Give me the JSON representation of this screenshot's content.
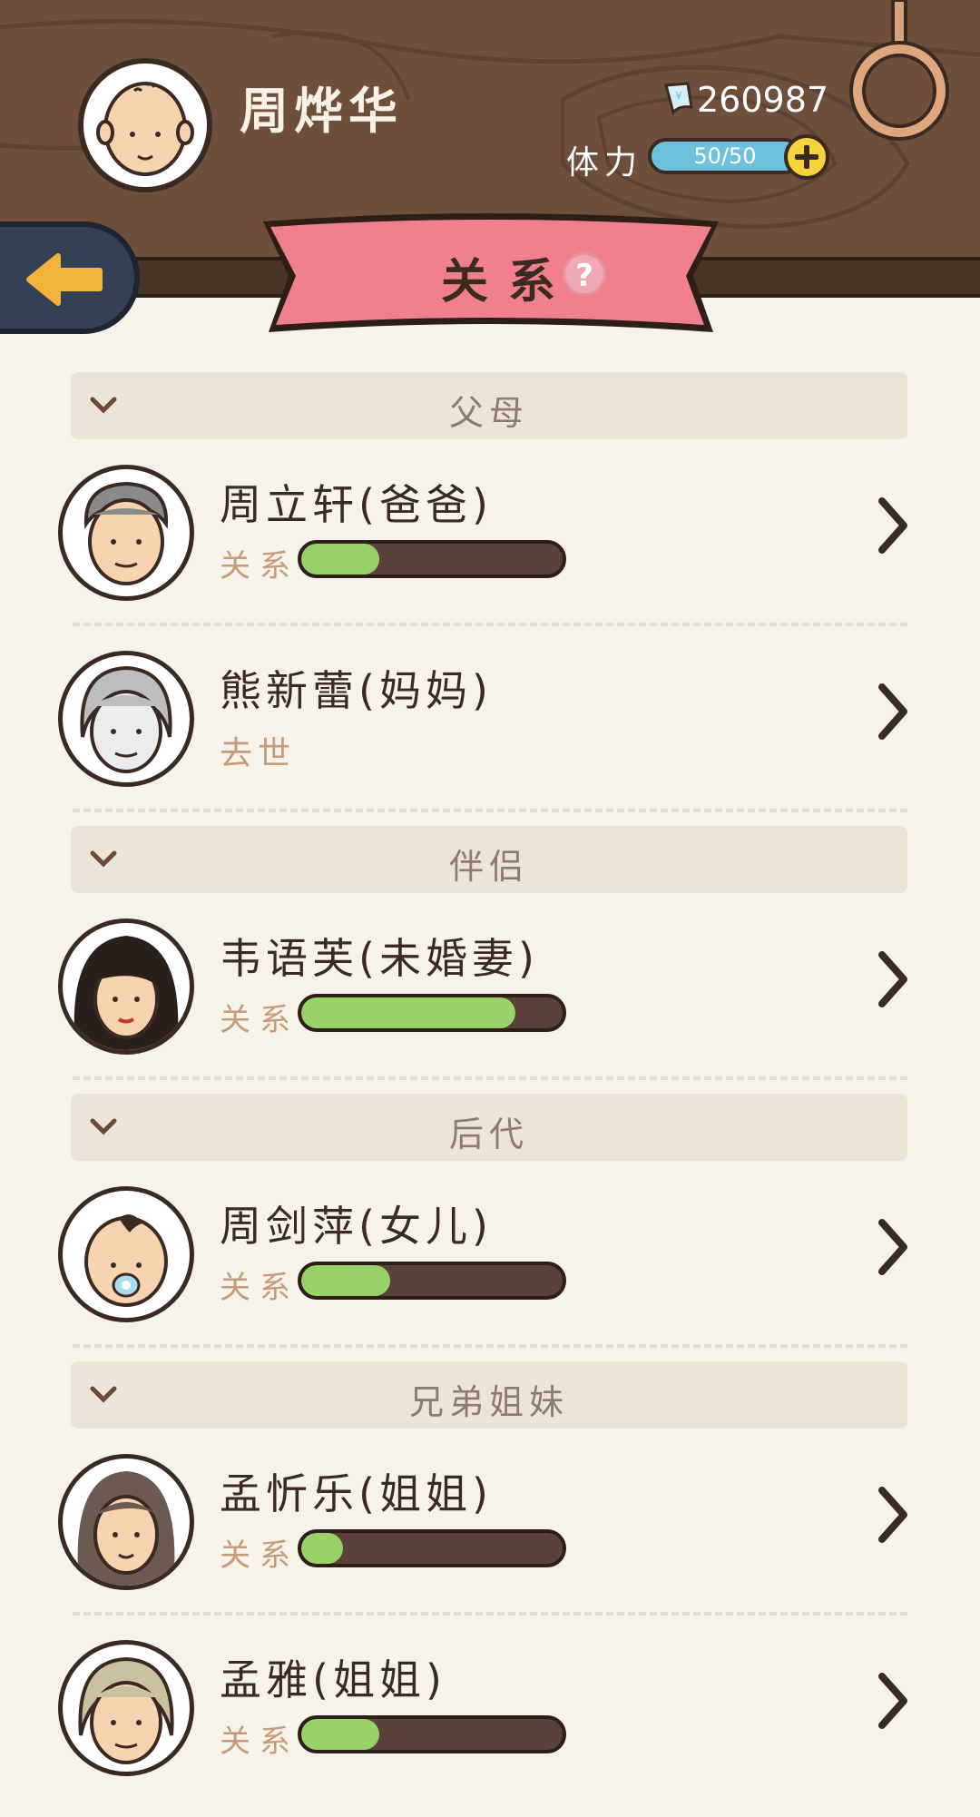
{
  "header": {
    "player_name": "周烨华",
    "money": "260987",
    "stamina_label": "体力",
    "stamina_value": "50/50"
  },
  "banner": {
    "title": "关系",
    "help": "?"
  },
  "sections": [
    {
      "title": "父母"
    },
    {
      "title": "伴侣"
    },
    {
      "title": "后代"
    },
    {
      "title": "兄弟姐妹"
    }
  ],
  "relationship_label": "关系",
  "people": [
    {
      "name": "周立轩(爸爸)",
      "relationship": 0.3,
      "status": "",
      "avatar": "old-man-avatar"
    },
    {
      "name": "熊新蕾(妈妈)",
      "relationship": null,
      "status": "去世",
      "avatar": "old-woman-grey-avatar"
    },
    {
      "name": "韦语芙(未婚妻)",
      "relationship": 0.82,
      "status": "",
      "avatar": "woman-avatar"
    },
    {
      "name": "周剑萍(女儿)",
      "relationship": 0.34,
      "status": "",
      "avatar": "baby-avatar"
    },
    {
      "name": "孟忻乐(姐姐)",
      "relationship": 0.16,
      "status": "",
      "avatar": "woman-long-hair-avatar"
    },
    {
      "name": "孟雅(姐姐)",
      "relationship": 0.3,
      "status": "",
      "avatar": "old-woman-avatar"
    }
  ],
  "colors": {
    "header_wood": "#6e4f3c",
    "banner_pink": "#f0808e",
    "bar_fill": "#9ad26a",
    "stamina_blue": "#6ec1da",
    "back_button": "#344054",
    "back_arrow": "#f2b33d"
  }
}
